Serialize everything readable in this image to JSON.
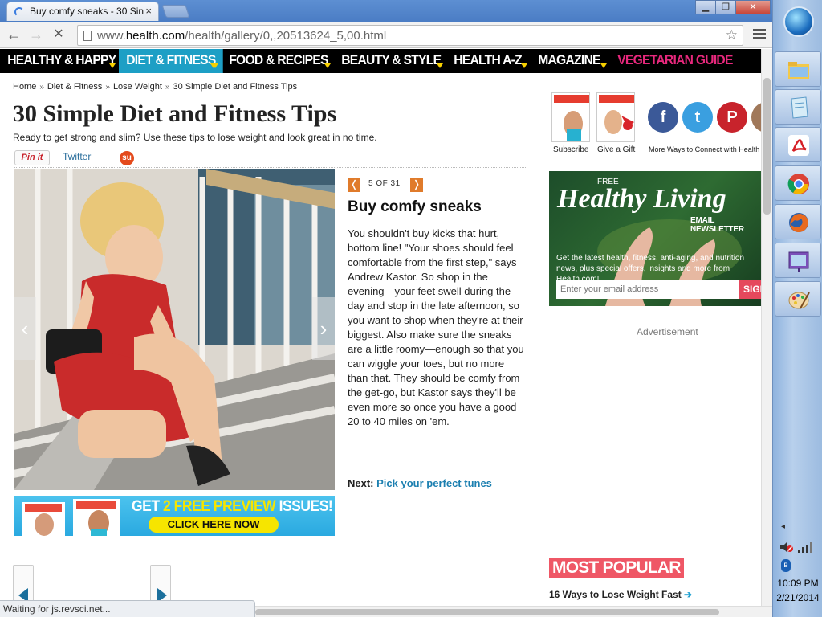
{
  "browser": {
    "tab_title": "Buy comfy sneaks - 30 Sin",
    "tab_close": "×",
    "url_prefix": "www.",
    "url_host": "health.com",
    "url_path": "/health/gallery/0,,20513624_5,00.html",
    "status_text": "Waiting for js.revsci.net...",
    "back": "←",
    "forward": "→",
    "reload": "✕",
    "star": "☆",
    "btn_min": "▁",
    "btn_max": "❐",
    "btn_close": "✕"
  },
  "site_nav": [
    {
      "label": "HEALTHY & HAPPY"
    },
    {
      "label": "DIET & FITNESS"
    },
    {
      "label": "FOOD & RECIPES"
    },
    {
      "label": "BEAUTY & STYLE"
    },
    {
      "label": "HEALTH A-Z"
    },
    {
      "label": "MAGAZINE"
    },
    {
      "label": "VEGETARIAN GUIDE",
      "color": "#e8287d"
    }
  ],
  "breadcrumb": [
    "Home",
    "Diet & Fitness",
    "Lose Weight",
    "30 Simple Diet and Fitness Tips"
  ],
  "breadcrumb_sep": "»",
  "article": {
    "title": "30 Simple Diet and Fitness Tips",
    "subtitle": "Ready to get strong and slim? Use these tips to lose weight and look great in no time.",
    "pin_label": "Pin it",
    "twitter_label": "Twitter",
    "stumble_glyph": "su"
  },
  "slide": {
    "counter": "5 OF 31",
    "prev": "❬",
    "next": "❭",
    "title": "Buy comfy sneaks",
    "body": "You shouldn't buy kicks that hurt, bottom line! \"Your shoes should feel comfortable from the first step,\" says Andrew Kastor. So shop in the evening—your feet swell during the day and stop in the late afternoon, so you want to shop when they're at their biggest. Also make sure the sneaks are a little roomy—enough so that you can wiggle your toes, but no more than that. They should be comfy from the get-go, but Kastor says they'll be even more so once you have a good 20 to 40 miles on 'em.",
    "next_label": "Next:",
    "next_link": "Pick your perfect tunes"
  },
  "photo_nav": {
    "prev": "‹",
    "next": "›"
  },
  "promo": {
    "headline_a": "GET ",
    "headline_b": "2 FREE PREVIEW",
    "headline_c": " ISSUES!",
    "cta": "CLICK HERE NOW"
  },
  "right_col": {
    "subscribe": "Subscribe",
    "gift": "Give a Gift",
    "more_ways": "More Ways to Connect with Health",
    "social": [
      {
        "name": "facebook",
        "glyph": "f",
        "color": "#3b5998"
      },
      {
        "name": "twitter",
        "glyph": "t",
        "color": "#3a9fe0"
      },
      {
        "name": "pinterest",
        "glyph": "P",
        "color": "#c8232c"
      }
    ],
    "newsletter": {
      "free": "FREE",
      "title": "Healthy Living",
      "subtitle": "EMAIL NEWSLETTER",
      "desc": "Get the latest health, fitness, anti-aging, and nutrition news, plus special offers, insights and more from Health.com!",
      "placeholder": "Enter your email address",
      "signup": "SIGN"
    },
    "ad_label": "Advertisement",
    "most_popular": "MOST POPULAR",
    "popular_1": "16 Ways to Lose Weight Fast",
    "popular_arrow": "➔"
  },
  "tray": {
    "time": "10:09 PM",
    "date": "2/21/2014",
    "arrow": "◂"
  }
}
